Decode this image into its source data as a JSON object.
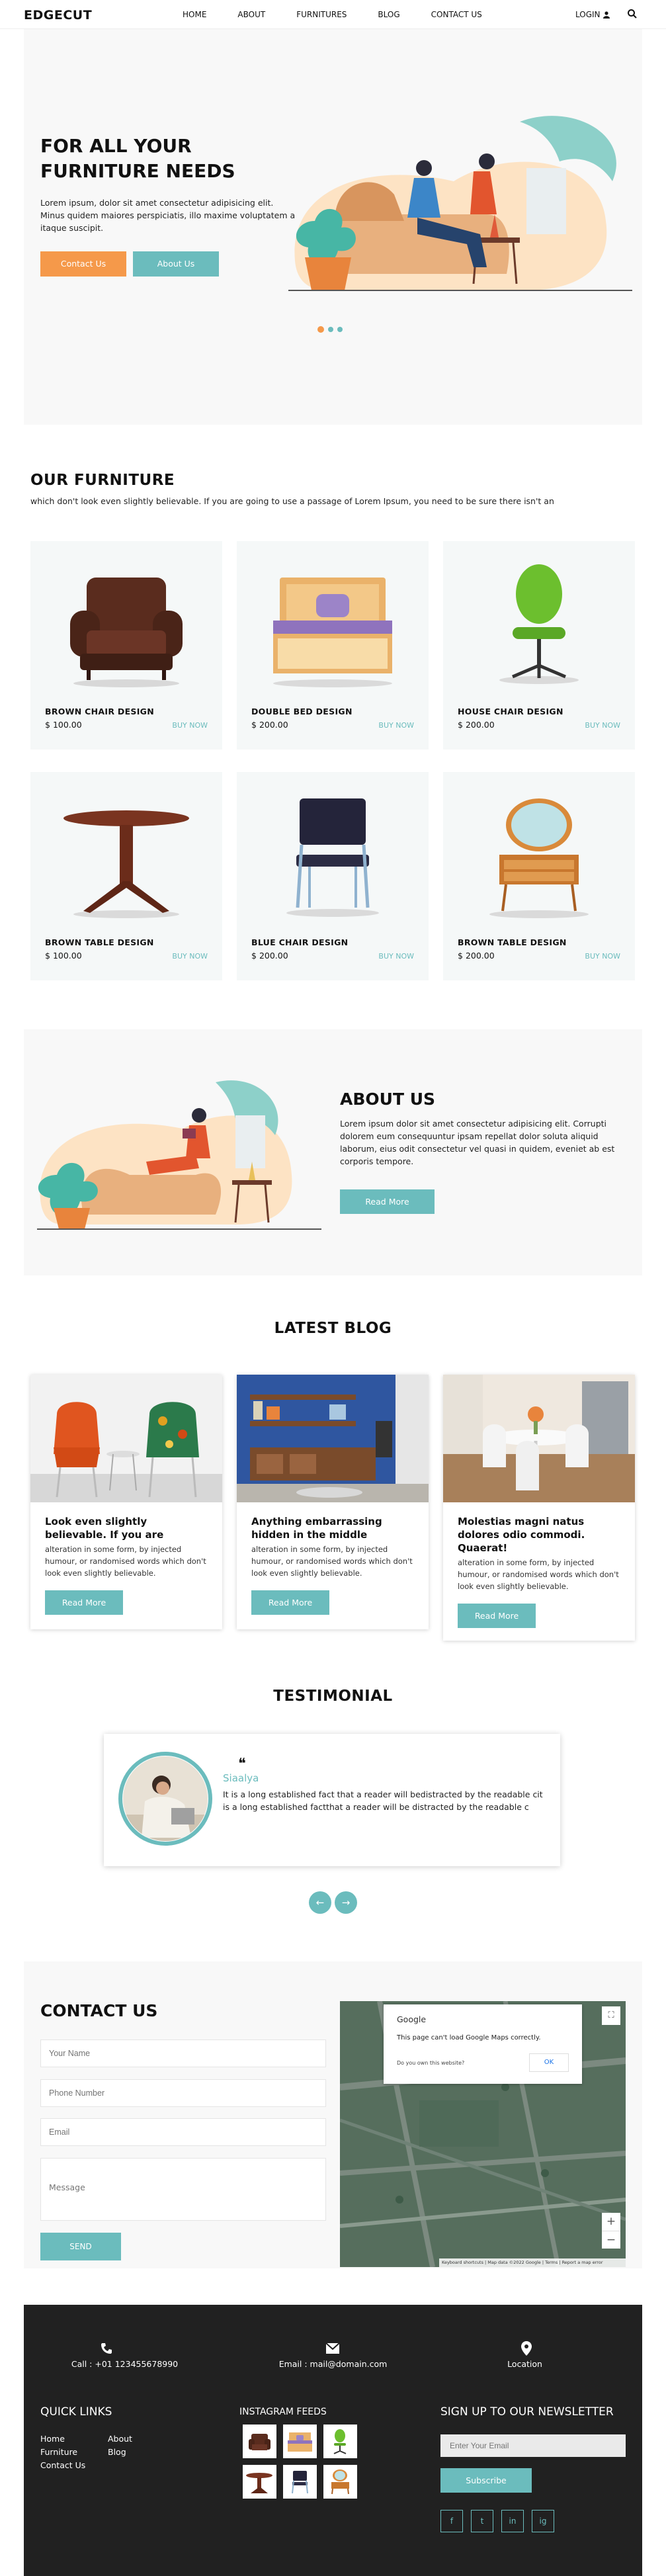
{
  "header": {
    "logo": "EDGECUT",
    "nav": [
      "HOME",
      "ABOUT",
      "FURNITURES",
      "BLOG",
      "CONTACT US"
    ],
    "login": "LOGIN"
  },
  "hero": {
    "title": "FOR ALL YOUR FURNITURE NEEDS",
    "text": "Lorem ipsum, dolor sit amet consectetur adipisicing elit. Minus quidem maiores perspiciatis, illo maxime voluptatem a itaque suscipit.",
    "btn_contact": "Contact Us",
    "btn_about": "About Us"
  },
  "furniture": {
    "title": "OUR FURNITURE",
    "subtitle": "which don't look even slightly believable. If you are going to use a passage of Lorem Ipsum, you need to be sure there isn't an",
    "buy_label": "BUY NOW",
    "currency": "$",
    "items": [
      {
        "name": "BROWN CHAIR DESIGN",
        "price": "100.00"
      },
      {
        "name": "DOUBLE BED DESIGN",
        "price": "200.00"
      },
      {
        "name": "HOUSE CHAIR DESIGN",
        "price": "200.00"
      },
      {
        "name": "BROWN TABLE DESIGN",
        "price": "100.00"
      },
      {
        "name": "BLUE CHAIR DESIGN",
        "price": "200.00"
      },
      {
        "name": "BROWN TABLE DESIGN",
        "price": "200.00"
      }
    ]
  },
  "about": {
    "title": "ABOUT US",
    "text": "Lorem ipsum dolor sit amet consectetur adipisicing elit. Corrupti dolorem eum consequuntur ipsam repellat dolor soluta aliquid laborum, eius odit consectetur vel quasi in quidem, eveniet ab est corporis tempore.",
    "btn": "Read More"
  },
  "blog": {
    "title": "LATEST BLOG",
    "read_more": "Read More",
    "posts": [
      {
        "title": "Look even slightly believable. If you are",
        "text": "alteration in some form, by injected humour, or randomised words which don't look even slightly believable."
      },
      {
        "title": "Anything embarrassing hidden in the middle",
        "text": "alteration in some form, by injected humour, or randomised words which don't look even slightly believable."
      },
      {
        "title": "Molestias magni natus dolores odio commodi. Quaerat!",
        "text": "alteration in some form, by injected humour, or randomised words which don't look even slightly believable."
      }
    ]
  },
  "testimonial": {
    "title": "TESTIMONIAL",
    "quote_mark": "❝",
    "name": "Siaalya",
    "text": "It is a long established fact that a reader will bedistracted by the readable cit is a long established factthat a reader will be distracted by the readable c",
    "prev": "←",
    "next": "→"
  },
  "contact": {
    "title": "CONTACT US",
    "name_ph": "Your Name",
    "phone_ph": "Phone Number",
    "email_ph": "Email",
    "message_ph": "Message",
    "send": "SEND",
    "map": {
      "google": "Google",
      "error": "This page can't load Google Maps correctly.",
      "own": "Do you own this website?",
      "ok": "OK",
      "footer": "Keyboard shortcuts  |  Map data ©2022 Google  |  Terms  |  Report a map error"
    }
  },
  "footer": {
    "call": "Call : +01 123455678990",
    "email": "Email : mail@domain.com",
    "location": "Location",
    "quick_links_title": "QUICK LINKS",
    "links_col1": [
      "Home",
      "Furniture",
      "Contact Us"
    ],
    "links_col2": [
      "About",
      "Blog"
    ],
    "instagram_title": "INSTAGRAM FEEDS",
    "newsletter_title": "SIGN UP TO OUR NEWSLETTER",
    "newsletter_ph": "Enter Your Email",
    "subscribe": "Subscribe",
    "social": [
      "f",
      "t",
      "in",
      "ig"
    ]
  },
  "colors": {
    "accent": "#6bbcbd",
    "orange": "#f5994a",
    "dark": "#212121"
  }
}
